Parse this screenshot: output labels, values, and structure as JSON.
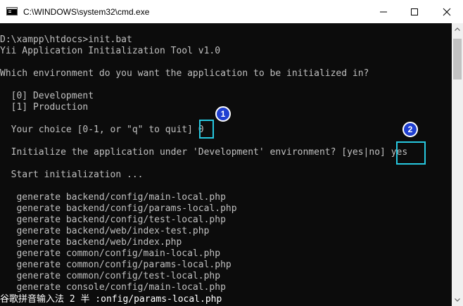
{
  "window": {
    "title": "C:\\WINDOWS\\system32\\cmd.exe",
    "controls": [
      "minimize",
      "maximize",
      "close"
    ]
  },
  "console": {
    "lines": [
      "D:\\xampp\\htdocs>init.bat",
      "Yii Application Initialization Tool v1.0",
      "",
      "Which environment do you want the application to be initialized in?",
      "",
      "  [0] Development",
      "  [1] Production",
      "",
      "  Your choice [0-1, or \"q\" to quit] 0",
      "",
      "  Initialize the application under 'Development' environment? [yes|no] yes",
      "",
      "  Start initialization ...",
      "",
      "   generate backend/config/main-local.php",
      "   generate backend/config/params-local.php",
      "   generate backend/config/test-local.php",
      "   generate backend/web/index-test.php",
      "   generate backend/web/index.php",
      "   generate common/config/main-local.php",
      "   generate common/config/params-local.php",
      "   generate common/config/test-local.php",
      "   generate console/config/main-local.php"
    ],
    "ime_bar": "谷歌拼音输入法 2 半 :onfig/params-local.php"
  },
  "annotations": {
    "badge_1": "1",
    "badge_2": "2",
    "highlight_color": "#27c8e0",
    "badge_color": "#1f3fd1"
  },
  "icons": {
    "app": "console-app-icon",
    "minimize": "minimize-icon",
    "maximize": "maximize-icon",
    "close": "close-icon"
  }
}
